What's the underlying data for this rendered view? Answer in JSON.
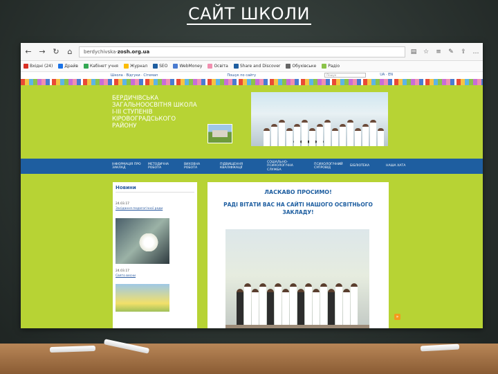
{
  "slide": {
    "title": "САЙТ ШКОЛИ"
  },
  "browser": {
    "url_prefix": "berdychivska-",
    "url_main": "zosh.org.ua",
    "nav_back": "←",
    "nav_forward": "→",
    "nav_refresh": "↻",
    "nav_home": "⌂"
  },
  "bookmarks": [
    {
      "label": "Вхідні (24)",
      "color": "#d93025"
    },
    {
      "label": "Драйв",
      "color": "#1a73e8"
    },
    {
      "label": "Кабінет учня",
      "color": "#34a853"
    },
    {
      "label": "Журнал",
      "color": "#fbbc04"
    },
    {
      "label": "SEO",
      "color": "#1e5ea0"
    },
    {
      "label": "WebMoney",
      "color": "#4a7bd0"
    },
    {
      "label": "Освіта",
      "color": "#f18fb0"
    },
    {
      "label": "Share and Discover",
      "color": "#1e5ea0"
    },
    {
      "label": "Обухівське",
      "color": "#666666"
    },
    {
      "label": "Радіо",
      "color": "#8bc34a"
    }
  ],
  "site": {
    "topbar_left": "Школа · Відгуки · Сітемап",
    "topbar_mid": "Пошук по сайту",
    "search_placeholder": "Пошук",
    "lang": "UA · EN",
    "school_name_lines": [
      "БЕРДИЧІВСЬКА",
      "ЗАГАЛЬНООСВІТНЯ ШКОЛА",
      "І-ІІІ СТУПЕНІВ",
      "КІРОВОГРАДСЬКОГО",
      "РАЙОНУ"
    ],
    "banner_dots": "● ● ● ● ● ● ● ●",
    "nav": [
      "Інформація про заклад",
      "Методична робота",
      "Виховна робота",
      "Підвищення кваліфікації",
      "Соціально-психологічна служба",
      "Психологічний супровід",
      "Бібліотека",
      "Наша хата"
    ],
    "news": {
      "title": "Новини",
      "date1": "24.03.17",
      "link1": "Засідання педагогічної ради",
      "date2": "24.03.17",
      "link2": "Свято весни"
    },
    "welcome": "ЛАСКАВО ПРОСИМО!",
    "welcome_text": "РАДІ ВІТАТИ ВАС НА САЙТІ НАШОГО ОСВІТНЬОГО ЗАКЛАДУ!",
    "rss": "»"
  },
  "colors": {
    "page_bg": "#b7d334",
    "nav_bg": "#1e5ea0",
    "link": "#2a5aa0"
  }
}
